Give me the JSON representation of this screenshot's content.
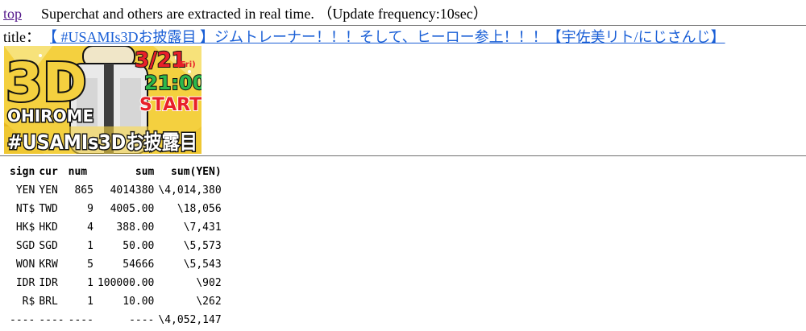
{
  "header": {
    "top_link": "top",
    "description": "Superchat and others are extracted in real time. （Update frequency:10sec）"
  },
  "title": {
    "label": "title：",
    "link_text": "【 #USAMIs3Dお披露目 】ジムトレーナー！！！そして、ヒーロー参上！！！【宇佐美リト/にじさんじ】"
  },
  "thumbnail": {
    "big_text": "3D",
    "subtitle": "OHIROME",
    "date": "3/21",
    "weekday": "(Fri)",
    "time": "21:00",
    "start": "START",
    "hashtag": "#USAMIs3Dお披露目",
    "colors": {
      "background": "#f4d03f",
      "accent_red": "#e8202a",
      "accent_green": "#2db84b",
      "outline": "#111111"
    }
  },
  "table": {
    "headers": [
      "sign",
      "cur",
      "num",
      "sum",
      "sum(YEN)"
    ],
    "rows": [
      [
        "YEN",
        "YEN",
        "865",
        "4014380",
        "\\4,014,380"
      ],
      [
        "NT$",
        "TWD",
        "9",
        "4005.00",
        "\\18,056"
      ],
      [
        "HK$",
        "HKD",
        "4",
        "388.00",
        "\\7,431"
      ],
      [
        "SGD",
        "SGD",
        "1",
        "50.00",
        "\\5,573"
      ],
      [
        "WON",
        "KRW",
        "5",
        "54666",
        "\\5,543"
      ],
      [
        "IDR",
        "IDR",
        "1",
        "100000.00",
        "\\902"
      ],
      [
        "R$",
        "BRL",
        "1",
        "10.00",
        "\\262"
      ]
    ],
    "footer": [
      "----",
      "----",
      "----",
      "----",
      "\\4,052,147"
    ]
  }
}
